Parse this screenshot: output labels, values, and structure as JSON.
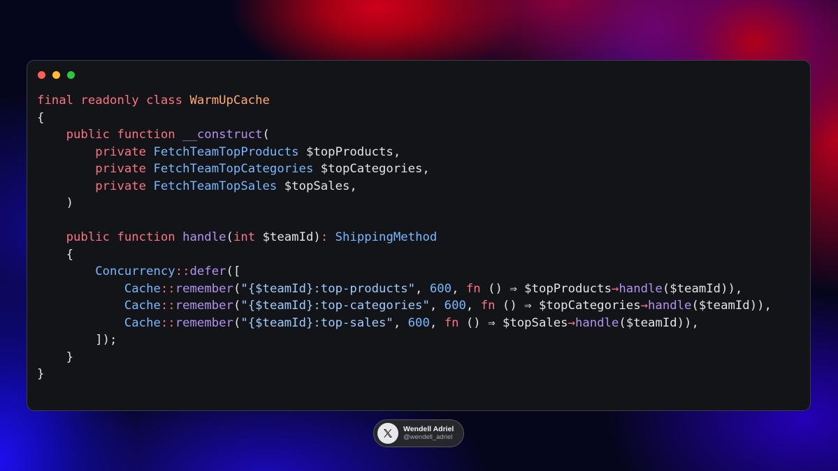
{
  "colors": {
    "dot_close": "#ff5f57",
    "dot_minimize": "#febc2e",
    "dot_maximize": "#28c840",
    "window_bg": "#121417",
    "keyword": "#f97583",
    "class_name": "#ffab70",
    "function": "#b392f0",
    "type": "#79b8ff",
    "string": "#9ecbff",
    "plain": "#e1e4e8"
  },
  "code": {
    "lines": [
      [
        [
          "kw",
          "final readonly class "
        ],
        [
          "cls",
          "WarmUpCache"
        ]
      ],
      [
        [
          "op",
          "{"
        ]
      ],
      [
        [
          "op",
          "    "
        ],
        [
          "kw",
          "public function "
        ],
        [
          "fn",
          "__construct"
        ],
        [
          "op",
          "("
        ]
      ],
      [
        [
          "op",
          "        "
        ],
        [
          "kw",
          "private "
        ],
        [
          "ty",
          "FetchTeamTopProducts "
        ],
        [
          "var",
          "$topProducts,"
        ]
      ],
      [
        [
          "op",
          "        "
        ],
        [
          "kw",
          "private "
        ],
        [
          "ty",
          "FetchTeamTopCategories "
        ],
        [
          "var",
          "$topCategories,"
        ]
      ],
      [
        [
          "op",
          "        "
        ],
        [
          "kw",
          "private "
        ],
        [
          "ty",
          "FetchTeamTopSales "
        ],
        [
          "var",
          "$topSales,"
        ]
      ],
      [
        [
          "op",
          "    )"
        ]
      ],
      [
        [
          "op",
          ""
        ]
      ],
      [
        [
          "op",
          "    "
        ],
        [
          "kw",
          "public function "
        ],
        [
          "fn",
          "handle"
        ],
        [
          "op",
          "("
        ],
        [
          "kw",
          "int "
        ],
        [
          "var",
          "$teamId"
        ],
        [
          "op",
          ")"
        ],
        [
          "kw",
          ": "
        ],
        [
          "ty",
          "ShippingMethod"
        ]
      ],
      [
        [
          "op",
          "    {"
        ]
      ],
      [
        [
          "op",
          "        "
        ],
        [
          "ty",
          "Concurrency"
        ],
        [
          "kw",
          "::"
        ],
        [
          "fn",
          "defer"
        ],
        [
          "op",
          "(["
        ]
      ],
      [
        [
          "op",
          "            "
        ],
        [
          "ty",
          "Cache"
        ],
        [
          "kw",
          "::"
        ],
        [
          "fn",
          "remember"
        ],
        [
          "op",
          "("
        ],
        [
          "str",
          "\"{$teamId}:top-products\""
        ],
        [
          "op",
          ", "
        ],
        [
          "num",
          "600"
        ],
        [
          "op",
          ", "
        ],
        [
          "kw",
          "fn "
        ],
        [
          "op",
          "() ⇒ "
        ],
        [
          "var",
          "$topProducts"
        ],
        [
          "arr",
          "→"
        ],
        [
          "fn",
          "handle"
        ],
        [
          "op",
          "($teamId)),"
        ]
      ],
      [
        [
          "op",
          "            "
        ],
        [
          "ty",
          "Cache"
        ],
        [
          "kw",
          "::"
        ],
        [
          "fn",
          "remember"
        ],
        [
          "op",
          "("
        ],
        [
          "str",
          "\"{$teamId}:top-categories\""
        ],
        [
          "op",
          ", "
        ],
        [
          "num",
          "600"
        ],
        [
          "op",
          ", "
        ],
        [
          "kw",
          "fn "
        ],
        [
          "op",
          "() ⇒ "
        ],
        [
          "var",
          "$topCategories"
        ],
        [
          "arr",
          "→"
        ],
        [
          "fn",
          "handle"
        ],
        [
          "op",
          "($teamId)),"
        ]
      ],
      [
        [
          "op",
          "            "
        ],
        [
          "ty",
          "Cache"
        ],
        [
          "kw",
          "::"
        ],
        [
          "fn",
          "remember"
        ],
        [
          "op",
          "("
        ],
        [
          "str",
          "\"{$teamId}:top-sales\""
        ],
        [
          "op",
          ", "
        ],
        [
          "num",
          "600"
        ],
        [
          "op",
          ", "
        ],
        [
          "kw",
          "fn "
        ],
        [
          "op",
          "() ⇒ "
        ],
        [
          "var",
          "$topSales"
        ],
        [
          "arr",
          "→"
        ],
        [
          "fn",
          "handle"
        ],
        [
          "op",
          "($teamId)),"
        ]
      ],
      [
        [
          "op",
          "        ]);"
        ]
      ],
      [
        [
          "op",
          "    }"
        ]
      ],
      [
        [
          "op",
          "}"
        ]
      ]
    ]
  },
  "badge": {
    "icon": "x-logo-icon",
    "name": "Wendell Adriel",
    "handle": "@wendell_adriel"
  }
}
